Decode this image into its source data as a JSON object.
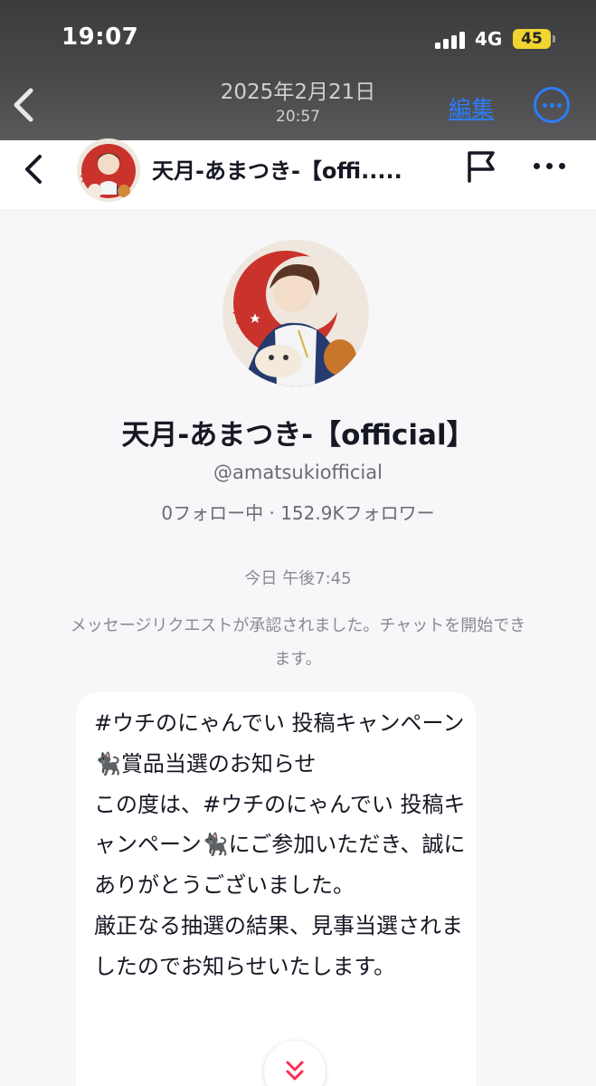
{
  "status_bar": {
    "time": "19:07",
    "network": "4G",
    "battery": "45",
    "battery_color": "#f0d430"
  },
  "photo_viewer": {
    "date": "2025年2月21日",
    "time": "20:57",
    "edit_label": "編集",
    "accent_color": "#2d7cf6",
    "icons": [
      "chevron-left-icon",
      "more-circle-icon"
    ]
  },
  "chat_header": {
    "name": "天月-あまつき-【offi.....",
    "icons": [
      "chevron-left-icon",
      "avatar",
      "flag-icon",
      "more-icon"
    ]
  },
  "profile": {
    "name": "天月-あまつき-【official】",
    "handle": "@amatsukiofficial",
    "stats": "0フォロー中 · 152.9Kフォロワー"
  },
  "conversation": {
    "timestamp": "今日 午後7:45",
    "system_message": "メッセージリクエストが承認されました。チャットを開始できます。",
    "message": "#ウチのにゃんでい 投稿キャンペーン🐈‍⬛賞品当選のお知らせ\nこの度は、#ウチのにゃんでい 投稿キャンペーン🐈‍⬛にご参加いただき、誠にありがとうございました。\n厳正なる抽選の結果、見事当選されましたのでお知らせいたします。"
  },
  "scroll_down_icon": "double-chevron-down-icon"
}
